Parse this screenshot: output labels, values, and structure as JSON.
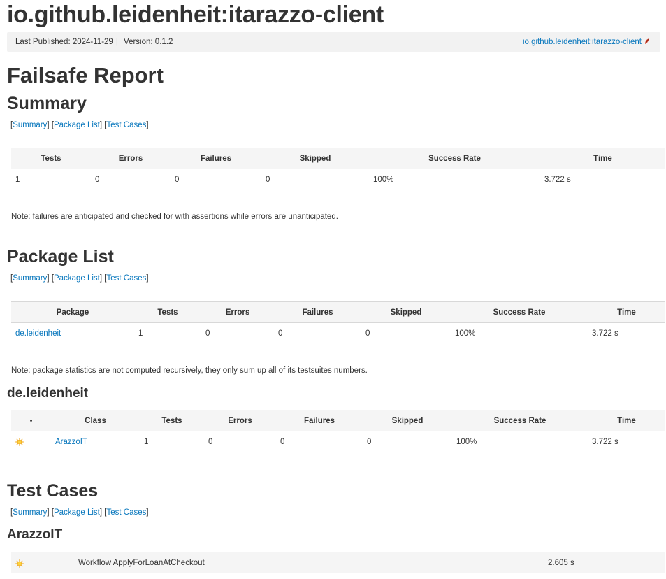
{
  "project": {
    "title": "io.github.leidenheit:itarazzo-client",
    "last_published_label": "Last Published:",
    "last_published": "2024-11-29",
    "version_label": "Version:",
    "version": "0.1.2",
    "breadcrumb_link": "io.github.leidenheit:itarazzo-client"
  },
  "report_title": "Failsafe Report",
  "nav": {
    "open": "[",
    "close": "]",
    "summary": "Summary",
    "package_list": "Package List",
    "test_cases": "Test Cases"
  },
  "summary": {
    "heading": "Summary",
    "headers": [
      "Tests",
      "Errors",
      "Failures",
      "Skipped",
      "Success Rate",
      "Time"
    ],
    "row": [
      "1",
      "0",
      "0",
      "0",
      "100%",
      "3.722 s"
    ],
    "note": "Note: failures are anticipated and checked for with assertions while errors are unanticipated."
  },
  "package_list": {
    "heading": "Package List",
    "headers": [
      "Package",
      "Tests",
      "Errors",
      "Failures",
      "Skipped",
      "Success Rate",
      "Time"
    ],
    "row": [
      "de.leidenheit",
      "1",
      "0",
      "0",
      "0",
      "100%",
      "3.722 s"
    ],
    "note": "Note: package statistics are not computed recursively, they only sum up all of its testsuites numbers."
  },
  "package_detail": {
    "heading": "de.leidenheit",
    "headers": [
      "-",
      "Class",
      "Tests",
      "Errors",
      "Failures",
      "Skipped",
      "Success Rate",
      "Time"
    ],
    "row": [
      "ArazzoIT",
      "1",
      "0",
      "0",
      "0",
      "100%",
      "3.722 s"
    ],
    "status_icon": "success-sun-icon"
  },
  "test_cases": {
    "heading": "Test Cases",
    "class_heading": "ArazzoIT",
    "rows": [
      {
        "name": "Workflow ApplyForLoanAtCheckout",
        "time": "2.605 s",
        "status_icon": "success-sun-icon"
      }
    ]
  },
  "colors": {
    "link": "#0877bd",
    "text": "#333333",
    "header_bg": "#f5f5f5",
    "bar_bg": "#f2f2f2"
  }
}
